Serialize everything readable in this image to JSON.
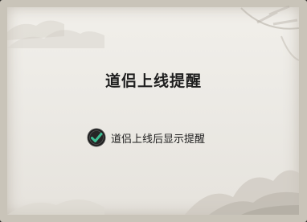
{
  "dialog": {
    "title": "道侣上线提醒",
    "option": {
      "label": "道侣上线后显示提醒",
      "checked": true,
      "icon": "checkmark-icon"
    }
  },
  "colors": {
    "frame": "#c9c4b9",
    "paper": "#eceae5",
    "check_ring": "#1c1c1c",
    "check_mark": "#3fbf95",
    "text": "#1f1f1f"
  }
}
